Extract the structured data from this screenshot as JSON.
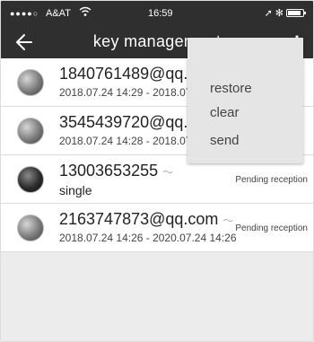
{
  "status_bar": {
    "signal": "●●●●○",
    "carrier": "A&AT",
    "time": "16:59"
  },
  "header": {
    "title": "key management",
    "back_icon": "arrow-left-icon",
    "more_icon": "kebab-menu-icon"
  },
  "keys": [
    {
      "name": "1840761489@qq.com",
      "validity": "2018.07.24 14:29 - 2018.07.24 14:29",
      "status": ""
    },
    {
      "name": "3545439720@qq.com",
      "validity": "2018.07.24 14:28 - 2018.07.24 14:28",
      "status": ""
    },
    {
      "name": "13003653255",
      "validity": "single",
      "status": "Pending reception"
    },
    {
      "name": "2163747873@qq.com",
      "validity": "2018.07.24 14:26 - 2020.07.24 14:26",
      "status": "Pending reception"
    }
  ],
  "menu": {
    "items": [
      "restore",
      "clear",
      "send"
    ]
  },
  "colors": {
    "bar": "#2f2f2f",
    "background": "#ececec",
    "menu": "#e5e5e5"
  }
}
